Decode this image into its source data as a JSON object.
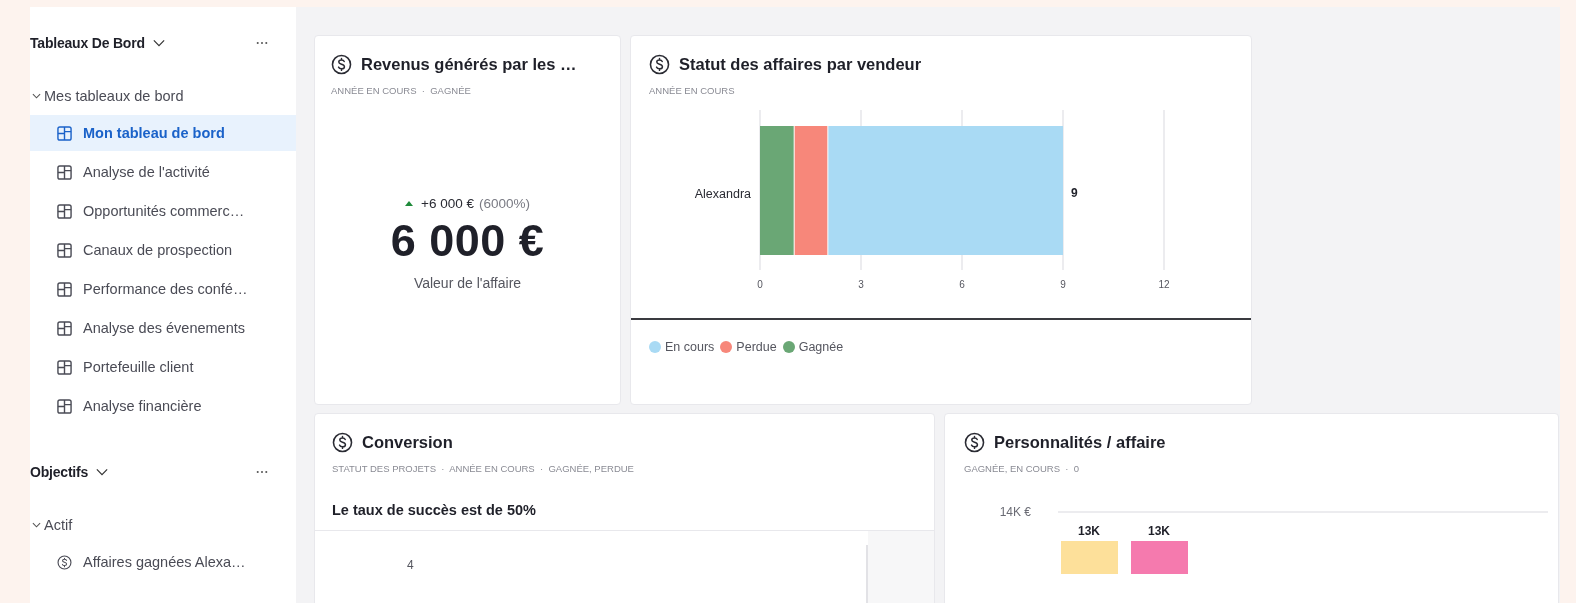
{
  "sidebar": {
    "sections": [
      {
        "title": "Tableaux De Bord",
        "expanded": true,
        "groups": [
          {
            "label": "Mes tableaux de bord",
            "expanded": true,
            "children": [
              {
                "label": "Mon tableau de bord",
                "selected": true
              },
              {
                "label": "Analyse de l'activité",
                "selected": false
              },
              {
                "label": "Opportunités commerc…",
                "selected": false
              },
              {
                "label": "Canaux de prospection",
                "selected": false
              },
              {
                "label": "Performance des confé…",
                "selected": false
              },
              {
                "label": "Analyse des évenements",
                "selected": false
              },
              {
                "label": "Portefeuille client",
                "selected": false
              },
              {
                "label": "Analyse financière",
                "selected": false
              }
            ]
          }
        ]
      },
      {
        "title": "Objectifs",
        "expanded": true,
        "groups": [
          {
            "label": "Actif",
            "expanded": true,
            "children": [
              {
                "label": "Affaires gagnées Alexa…",
                "selected": false
              }
            ]
          }
        ]
      }
    ]
  },
  "cards": [
    {
      "kind": "metric",
      "title": "Revenus générés par les …",
      "subtitle": "ANNÉE EN COURS  ·  GAGNÉE",
      "change": "+6 000 €",
      "change_pct": "(6000%)",
      "value": "6 000 €",
      "caption": "Valeur de l'affaire"
    },
    {
      "kind": "bar_h",
      "title": "Statut des affaires par vendeur",
      "subtitle": "ANNÉE EN COURS",
      "chart_data": {
        "type": "bar",
        "orientation": "horizontal",
        "stacked": true,
        "categories": [
          "Alexandra"
        ],
        "series": [
          {
            "name": "Gagnée",
            "color": "#6aa775",
            "values": [
              1
            ]
          },
          {
            "name": "Perdue",
            "color": "#f7877a",
            "values": [
              1
            ]
          },
          {
            "name": "En cours",
            "color": "#a9daf4",
            "values": [
              7
            ]
          }
        ],
        "xlim": [
          0,
          12
        ],
        "xticks": [
          0,
          3,
          6,
          9,
          12
        ],
        "grid": true,
        "value_labels": [
          "9"
        ]
      }
    },
    {
      "kind": "conversion",
      "title": "Conversion",
      "subtitle": "STATUT DES PROJETS  ·  ANNÉE EN COURS  ·  GAGNÉE, PERDUE",
      "headline": "Le taux de succès est de 50%",
      "axis_label": "4"
    },
    {
      "kind": "bar_v",
      "title": "Personnalités / affaire",
      "subtitle": "GAGNÉE, EN COURS  ·  0",
      "y_tick": "14K €",
      "bars": [
        {
          "value_label": "13K",
          "color": "#fde09a"
        },
        {
          "value_label": "13K",
          "color": "#f57aae"
        }
      ]
    }
  ]
}
